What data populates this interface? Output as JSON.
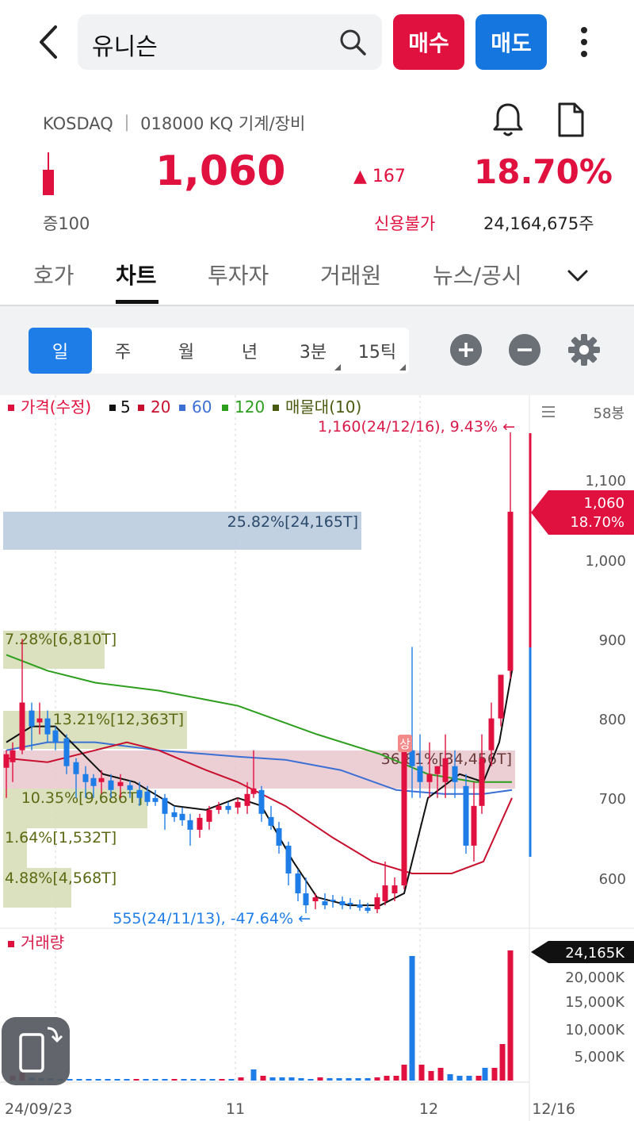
{
  "header": {
    "search_value": "유니슨",
    "buy_label": "매수",
    "sell_label": "매도"
  },
  "stock": {
    "market_info": "KOSDAQ ｜ 018000 KQ 기계/장비",
    "price": "1,060",
    "change": "▲ 167",
    "change_pct": "18.70%",
    "margin": "증100",
    "credit": "신용불가",
    "volume": "24,164,675주"
  },
  "tabs": [
    {
      "label": "호가"
    },
    {
      "label": "차트"
    },
    {
      "label": "투자자"
    },
    {
      "label": "거래원"
    },
    {
      "label": "뉴스/공시"
    }
  ],
  "periods": [
    {
      "label": "일"
    },
    {
      "label": "주"
    },
    {
      "label": "월"
    },
    {
      "label": "년"
    },
    {
      "label": "3분"
    },
    {
      "label": "15틱"
    }
  ],
  "chart": {
    "legend": {
      "price": "가격(수정)",
      "ma5": "5",
      "ma20": "20",
      "ma60": "60",
      "ma120": "120",
      "profile": "매물대(10)"
    },
    "bars_count": "58봉",
    "high_note": "1,160(24/12/16), 9.43% ←",
    "low_note": "555(24/11/13), -47.64% ←",
    "current_price_tag": "1,060",
    "current_pct_tag": "18.70%",
    "y_ticks": [
      "1,100",
      "1,000",
      "900",
      "800",
      "700",
      "600"
    ],
    "volume_label": "거래량",
    "volume_ticks": [
      "20,000K",
      "15,000K",
      "10,000K",
      "5,000K"
    ],
    "volume_tag": "24,165K",
    "x_ticks": [
      "24/09/23",
      "11",
      "12",
      "12/16"
    ],
    "up_limit_marker": "상",
    "profile_labels": [
      "25.82%[24,165T]",
      "7.28%[6,810T]",
      "13.21%[12,363T]",
      "36.81%[34,456T]",
      "10.35%[9,686T]",
      "1.64%[1,532T]",
      "4.88%[4,568T]"
    ],
    "colors": {
      "up": "#e0103f",
      "down": "#1e7de6",
      "ma5": "#111111",
      "ma20": "#c8102e",
      "ma60": "#3b6fd4",
      "ma120": "#2e9e1f",
      "profile": "#7a8c1e"
    }
  },
  "chart_data": {
    "type": "candlestick",
    "x_labels": [
      "24/09/23",
      "11",
      "12",
      "12/16"
    ],
    "ylim": [
      555,
      1160
    ],
    "y_ticks": [
      600,
      700,
      800,
      900,
      1000,
      1100
    ],
    "last_close": 1060,
    "high": 1160,
    "low": 555,
    "volume_series": {
      "name": "거래량",
      "y_ticks": [
        5000,
        10000,
        15000,
        20000
      ],
      "unit": "K",
      "last_volume": 24165
    },
    "volume_profile": [
      {
        "label": "25.82%[24,165T]"
      },
      {
        "label": "7.28%[6,810T]"
      },
      {
        "label": "13.21%[12,363T]"
      },
      {
        "label": "36.81%[34,456T]"
      },
      {
        "label": "10.35%[9,686T]"
      },
      {
        "label": "1.64%[1,532T]"
      },
      {
        "label": "4.88%[4,568T]"
      }
    ]
  }
}
